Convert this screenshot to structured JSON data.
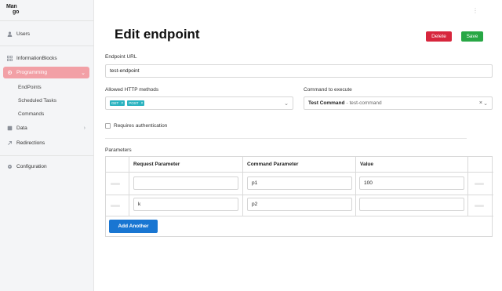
{
  "brand": {
    "line1": "Man",
    "line2": "go"
  },
  "sidebar": {
    "items": [
      {
        "label": "Users",
        "icon": "user-icon"
      },
      {
        "label": "InformationBlocks",
        "icon": "blocks-icon"
      },
      {
        "label": "Programming",
        "icon": "code-icon",
        "active": true
      },
      {
        "label": "Data",
        "icon": "data-icon"
      },
      {
        "label": "Redirections",
        "icon": "redirect-icon"
      },
      {
        "label": "Configuration",
        "icon": "gear-icon"
      }
    ],
    "sub_items": [
      "EndPoints",
      "Scheduled Tasks",
      "Commands"
    ]
  },
  "header": {
    "title": "Edit endpoint",
    "delete_label": "Delete",
    "save_label": "Save"
  },
  "form": {
    "endpoint_url_label": "Endpoint URL",
    "endpoint_url_value": "test-endpoint",
    "methods_label": "Allowed HTTP methods",
    "methods": [
      "GET",
      "POST"
    ],
    "command_label": "Command to execute",
    "command_name": "Test Command",
    "command_slug": "- test-command",
    "requires_auth_label": "Requires authentication"
  },
  "parameters": {
    "label": "Parameters",
    "columns": [
      "Request Parameter",
      "Command Parameter",
      "Value"
    ],
    "rows": [
      {
        "request": "",
        "command": "p1",
        "value": "100"
      },
      {
        "request": "k",
        "command": "p2",
        "value": ""
      }
    ],
    "add_label": "Add Another"
  },
  "colors": {
    "active_nav": "#f2a0a6",
    "delete": "#d7263d",
    "save": "#28a745",
    "primary": "#1976d2",
    "tag": "#2bb3c0"
  }
}
